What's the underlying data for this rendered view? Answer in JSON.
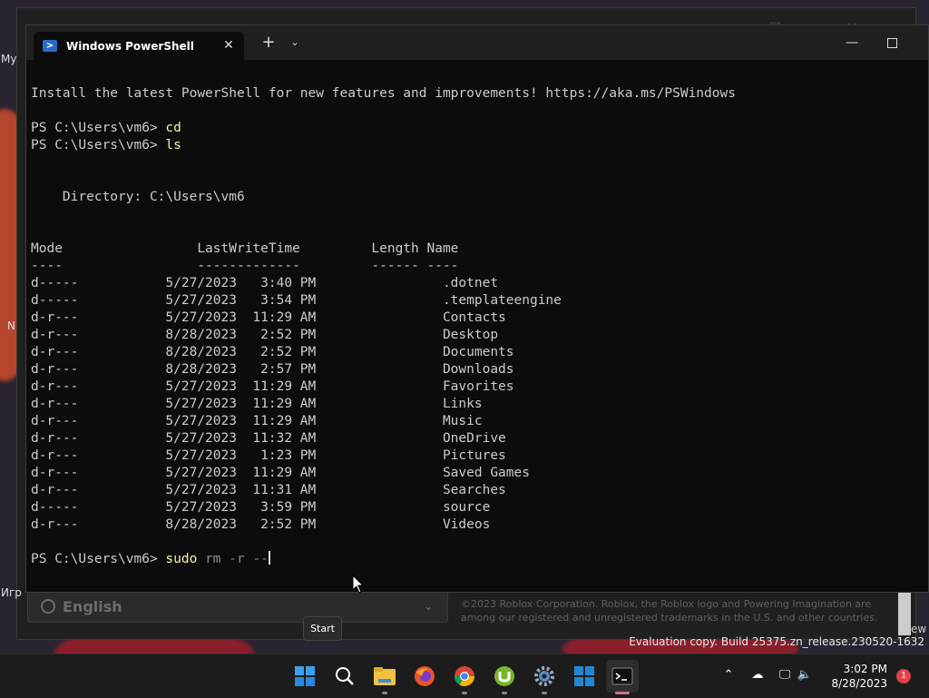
{
  "window": {
    "tab_title": "Windows PowerShell",
    "tab_icon": "powershell-icon"
  },
  "console": {
    "banner": "Install the latest PowerShell for new features and improvements! https://aka.ms/PSWindows",
    "prompt": "PS C:\\Users\\vm6> ",
    "history": [
      "cd",
      "ls"
    ],
    "directory_line": "    Directory: C:\\Users\\vm6",
    "table_header": "Mode                 LastWriteTime         Length Name",
    "table_rule": "----                 -------------         ------ ----",
    "columns": [
      "Mode",
      "LastWriteTime",
      "Length",
      "Name"
    ],
    "rows": [
      {
        "mode": "d-----",
        "date": "5/27/2023",
        "time": "3:40 PM",
        "name": ".dotnet"
      },
      {
        "mode": "d-----",
        "date": "5/27/2023",
        "time": "3:54 PM",
        "name": ".templateengine"
      },
      {
        "mode": "d-r---",
        "date": "5/27/2023",
        "time": "11:29 AM",
        "name": "Contacts"
      },
      {
        "mode": "d-r---",
        "date": "8/28/2023",
        "time": "2:52 PM",
        "name": "Desktop"
      },
      {
        "mode": "d-r---",
        "date": "8/28/2023",
        "time": "2:52 PM",
        "name": "Documents"
      },
      {
        "mode": "d-r---",
        "date": "8/28/2023",
        "time": "2:57 PM",
        "name": "Downloads"
      },
      {
        "mode": "d-r---",
        "date": "5/27/2023",
        "time": "11:29 AM",
        "name": "Favorites"
      },
      {
        "mode": "d-r---",
        "date": "5/27/2023",
        "time": "11:29 AM",
        "name": "Links"
      },
      {
        "mode": "d-r---",
        "date": "5/27/2023",
        "time": "11:29 AM",
        "name": "Music"
      },
      {
        "mode": "d-r---",
        "date": "5/27/2023",
        "time": "11:32 AM",
        "name": "OneDrive"
      },
      {
        "mode": "d-r---",
        "date": "5/27/2023",
        "time": "1:23 PM",
        "name": "Pictures"
      },
      {
        "mode": "d-r---",
        "date": "5/27/2023",
        "time": "11:29 AM",
        "name": "Saved Games"
      },
      {
        "mode": "d-r---",
        "date": "5/27/2023",
        "time": "11:31 AM",
        "name": "Searches"
      },
      {
        "mode": "d-----",
        "date": "5/27/2023",
        "time": "3:59 PM",
        "name": "source"
      },
      {
        "mode": "d-r---",
        "date": "8/28/2023",
        "time": "2:52 PM",
        "name": "Videos"
      }
    ],
    "current_input": {
      "command": "sudo",
      "args": "rm -r --"
    }
  },
  "background_window": {
    "language": "English",
    "legal_text": "©2023 Roblox Corporation. Roblox, the Roblox logo and Powering Imagination are among our registered and unregistered trademarks in the U.S. and other countries.",
    "edge_labels": [
      "My",
      "N",
      "Игр"
    ],
    "right_edge_fragment": "ew"
  },
  "tooltip": "Start",
  "watermark": "Evaluation copy. Build 25375.zn_release.230520-1632",
  "taskbar": {
    "apps": [
      "start-icon",
      "search-icon",
      "file-explorer-icon",
      "firefox-icon",
      "chrome-icon",
      "utorrent-icon",
      "settings-icon",
      "microsoft-store-icon",
      "terminal-icon"
    ],
    "time": "3:02 PM",
    "date": "8/28/2023",
    "notification_count": "1"
  }
}
